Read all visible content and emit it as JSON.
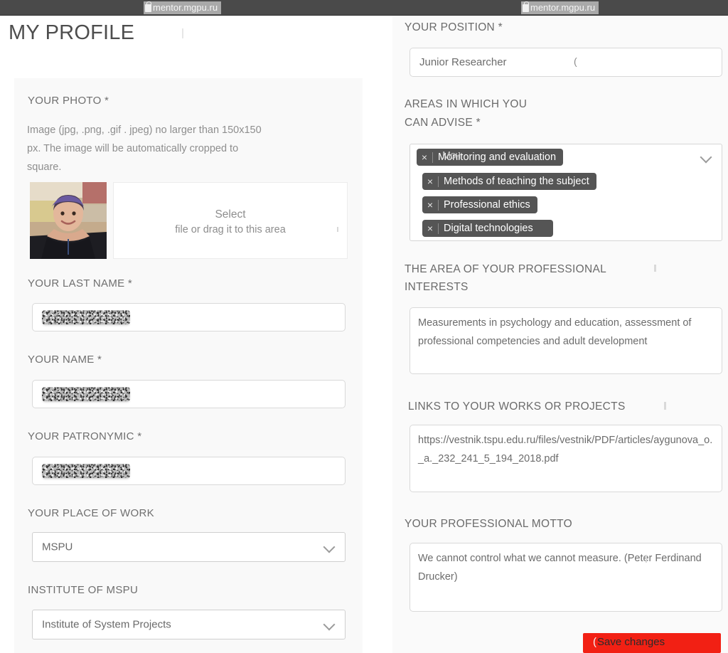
{
  "browser": {
    "tabs": [
      {
        "url": "mentor.mgpu.ru",
        "lock_icon": "lock-icon"
      },
      {
        "url": "mentor.mgpu.ru",
        "lock_icon": "lock-icon"
      }
    ]
  },
  "page": {
    "title": "MY PROFILE"
  },
  "left": {
    "photo": {
      "label": "YOUR PHOTO *",
      "help": "Image (jpg, .png, .gif . jpeg) no larger than 150x150 px. The image will be automatically cropped to square.",
      "dropzone_select": "Select",
      "dropzone_sub": "file or drag it to this area"
    },
    "last_name": {
      "label": "YOUR LAST NAME *",
      "value": ""
    },
    "first_name": {
      "label": "YOUR NAME *",
      "value": ""
    },
    "patronymic": {
      "label": "YOUR PATRONYMIC *",
      "value": ""
    },
    "place_of_work": {
      "label": "YOUR PLACE OF WORK",
      "value": "MSPU",
      "icon": "chevron-down-icon"
    },
    "institute": {
      "label": "INSTITUTE OF MSPU",
      "value": "Institute of System Projects",
      "icon": "chevron-down-icon"
    }
  },
  "right": {
    "position": {
      "label": "YOUR POSITION *",
      "value": "Junior Researcher"
    },
    "areas": {
      "label_line1": "AREAS IN WHICH YOU",
      "label_line2": "CAN ADVISE *",
      "icon": "chevron-down-icon",
      "tags": [
        {
          "label": "Monitoring and evaluation",
          "remove_icon": "close-icon"
        },
        {
          "label": "Methods of teaching the subject",
          "remove_icon": "close-icon"
        },
        {
          "label": "Professional ethics",
          "remove_icon": "close-icon"
        },
        {
          "label": "Digital technologies",
          "remove_icon": "close-icon"
        }
      ]
    },
    "interests": {
      "label_line1": "THE AREA OF YOUR PROFESSIONAL",
      "label_line2": "INTERESTS",
      "value": "Measurements in psychology and education, assessment of professional competencies and adult development"
    },
    "links": {
      "label": "LINKS TO YOUR WORKS OR PROJECTS",
      "value": "https://vestnik.tspu.edu.ru/files/vestnik/PDF/articles/aygunova_o._a._232_241_5_194_2018.pdf"
    },
    "motto": {
      "label": "YOUR PROFESSIONAL MOTTO",
      "value": "We cannot control what we cannot measure. (Peter Ferdinand Drucker)"
    },
    "save_button": {
      "label": "Save changes",
      "color": "#f22014"
    }
  }
}
